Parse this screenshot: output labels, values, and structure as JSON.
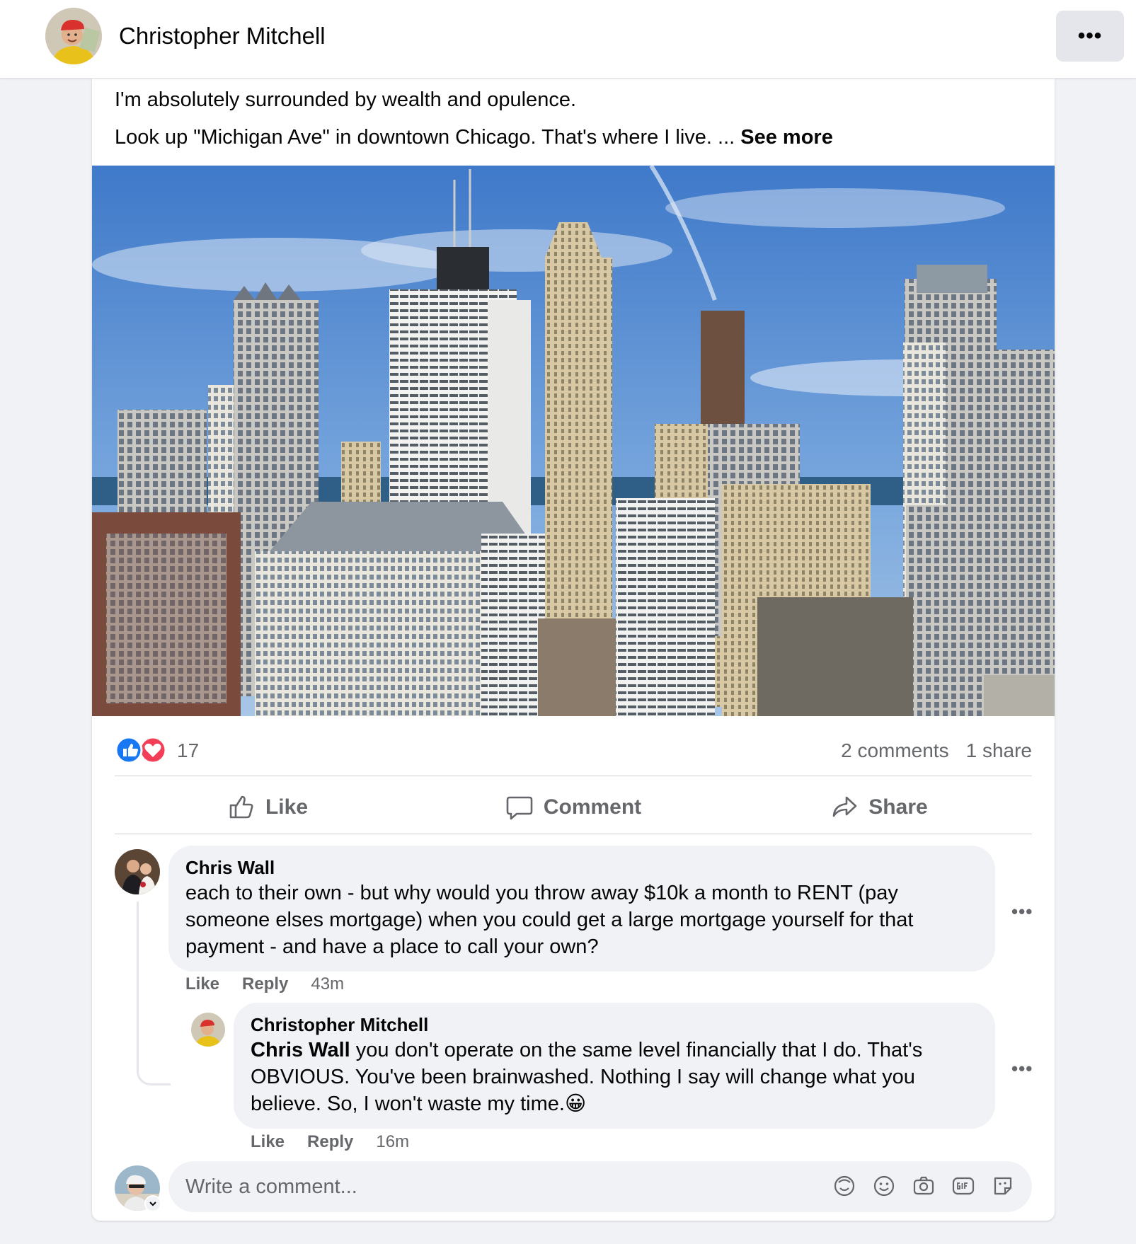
{
  "header": {
    "author_name": "Christopher Mitchell",
    "more_label": "•••"
  },
  "post": {
    "line1": "I'm absolutely surrounded by wealth and opulence.",
    "line2": "Look up \"Michigan Ave\" in downtown Chicago. That's where I live. ... ",
    "see_more": "See more",
    "photo_icon": "city-skyline-photo"
  },
  "reactions": {
    "icons": [
      "like-icon",
      "love-icon"
    ],
    "count": "17",
    "comments": "2 comments",
    "shares": "1 share"
  },
  "actions": {
    "like": "Like",
    "comment": "Comment",
    "share": "Share"
  },
  "comments": [
    {
      "author": "Chris Wall",
      "text": "each to their own - but why would you throw away $10k a month to RENT (pay someone elses mortgage) when you could get a large mortgage yourself for that payment - and have a place to call your own?",
      "like": "Like",
      "reply": "Reply",
      "time": "43m",
      "more": "•••"
    },
    {
      "author": "Christopher Mitchell",
      "mention": "Chris Wall",
      "text": " you don't operate on the same level financially that I do. That's OBVIOUS. You've been brainwashed. Nothing I say will change what you believe. So, I won't waste my time.",
      "emoji": "😀",
      "like": "Like",
      "reply": "Reply",
      "time": "16m",
      "more": "•••"
    }
  ],
  "composer": {
    "placeholder": "Write a comment...",
    "icons": [
      "avatar-sticker-icon",
      "emoji-icon",
      "camera-icon",
      "gif-icon",
      "sticker-icon"
    ]
  },
  "colors": {
    "like_blue": "#1877f2",
    "love_red": "#f33e58",
    "secondary_text": "#65676b",
    "bubble_bg": "#f0f2f5"
  }
}
